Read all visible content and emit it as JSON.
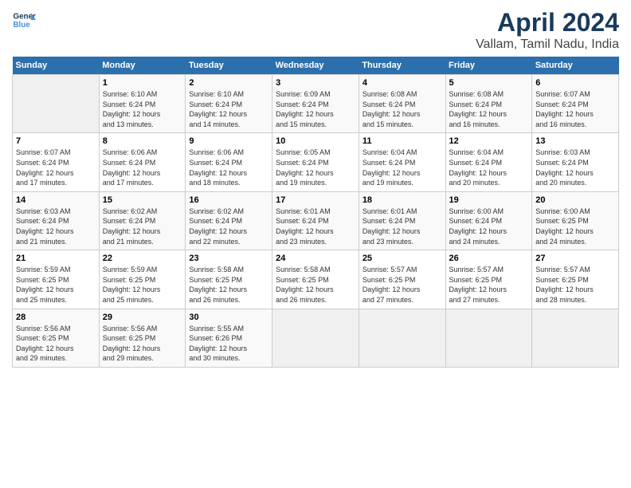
{
  "logo": {
    "text1": "General",
    "text2": "Blue"
  },
  "title": "April 2024",
  "subtitle": "Vallam, Tamil Nadu, India",
  "weekdays": [
    "Sunday",
    "Monday",
    "Tuesday",
    "Wednesday",
    "Thursday",
    "Friday",
    "Saturday"
  ],
  "weeks": [
    [
      {
        "day": "",
        "empty": true
      },
      {
        "day": "1",
        "rise": "6:10 AM",
        "set": "6:24 PM",
        "daylight": "12 hours and 13 minutes."
      },
      {
        "day": "2",
        "rise": "6:10 AM",
        "set": "6:24 PM",
        "daylight": "12 hours and 14 minutes."
      },
      {
        "day": "3",
        "rise": "6:09 AM",
        "set": "6:24 PM",
        "daylight": "12 hours and 15 minutes."
      },
      {
        "day": "4",
        "rise": "6:08 AM",
        "set": "6:24 PM",
        "daylight": "12 hours and 15 minutes."
      },
      {
        "day": "5",
        "rise": "6:08 AM",
        "set": "6:24 PM",
        "daylight": "12 hours and 16 minutes."
      },
      {
        "day": "6",
        "rise": "6:07 AM",
        "set": "6:24 PM",
        "daylight": "12 hours and 16 minutes."
      }
    ],
    [
      {
        "day": "7",
        "rise": "6:07 AM",
        "set": "6:24 PM",
        "daylight": "12 hours and 17 minutes."
      },
      {
        "day": "8",
        "rise": "6:06 AM",
        "set": "6:24 PM",
        "daylight": "12 hours and 17 minutes."
      },
      {
        "day": "9",
        "rise": "6:06 AM",
        "set": "6:24 PM",
        "daylight": "12 hours and 18 minutes."
      },
      {
        "day": "10",
        "rise": "6:05 AM",
        "set": "6:24 PM",
        "daylight": "12 hours and 19 minutes."
      },
      {
        "day": "11",
        "rise": "6:04 AM",
        "set": "6:24 PM",
        "daylight": "12 hours and 19 minutes."
      },
      {
        "day": "12",
        "rise": "6:04 AM",
        "set": "6:24 PM",
        "daylight": "12 hours and 20 minutes."
      },
      {
        "day": "13",
        "rise": "6:03 AM",
        "set": "6:24 PM",
        "daylight": "12 hours and 20 minutes."
      }
    ],
    [
      {
        "day": "14",
        "rise": "6:03 AM",
        "set": "6:24 PM",
        "daylight": "12 hours and 21 minutes."
      },
      {
        "day": "15",
        "rise": "6:02 AM",
        "set": "6:24 PM",
        "daylight": "12 hours and 21 minutes."
      },
      {
        "day": "16",
        "rise": "6:02 AM",
        "set": "6:24 PM",
        "daylight": "12 hours and 22 minutes."
      },
      {
        "day": "17",
        "rise": "6:01 AM",
        "set": "6:24 PM",
        "daylight": "12 hours and 23 minutes."
      },
      {
        "day": "18",
        "rise": "6:01 AM",
        "set": "6:24 PM",
        "daylight": "12 hours and 23 minutes."
      },
      {
        "day": "19",
        "rise": "6:00 AM",
        "set": "6:24 PM",
        "daylight": "12 hours and 24 minutes."
      },
      {
        "day": "20",
        "rise": "6:00 AM",
        "set": "6:25 PM",
        "daylight": "12 hours and 24 minutes."
      }
    ],
    [
      {
        "day": "21",
        "rise": "5:59 AM",
        "set": "6:25 PM",
        "daylight": "12 hours and 25 minutes."
      },
      {
        "day": "22",
        "rise": "5:59 AM",
        "set": "6:25 PM",
        "daylight": "12 hours and 25 minutes."
      },
      {
        "day": "23",
        "rise": "5:58 AM",
        "set": "6:25 PM",
        "daylight": "12 hours and 26 minutes."
      },
      {
        "day": "24",
        "rise": "5:58 AM",
        "set": "6:25 PM",
        "daylight": "12 hours and 26 minutes."
      },
      {
        "day": "25",
        "rise": "5:57 AM",
        "set": "6:25 PM",
        "daylight": "12 hours and 27 minutes."
      },
      {
        "day": "26",
        "rise": "5:57 AM",
        "set": "6:25 PM",
        "daylight": "12 hours and 27 minutes."
      },
      {
        "day": "27",
        "rise": "5:57 AM",
        "set": "6:25 PM",
        "daylight": "12 hours and 28 minutes."
      }
    ],
    [
      {
        "day": "28",
        "rise": "5:56 AM",
        "set": "6:25 PM",
        "daylight": "12 hours and 29 minutes."
      },
      {
        "day": "29",
        "rise": "5:56 AM",
        "set": "6:25 PM",
        "daylight": "12 hours and 29 minutes."
      },
      {
        "day": "30",
        "rise": "5:55 AM",
        "set": "6:26 PM",
        "daylight": "12 hours and 30 minutes."
      },
      {
        "day": "",
        "empty": true
      },
      {
        "day": "",
        "empty": true
      },
      {
        "day": "",
        "empty": true
      },
      {
        "day": "",
        "empty": true
      }
    ]
  ],
  "labels": {
    "sunrise": "Sunrise:",
    "sunset": "Sunset:",
    "daylight": "Daylight:"
  }
}
